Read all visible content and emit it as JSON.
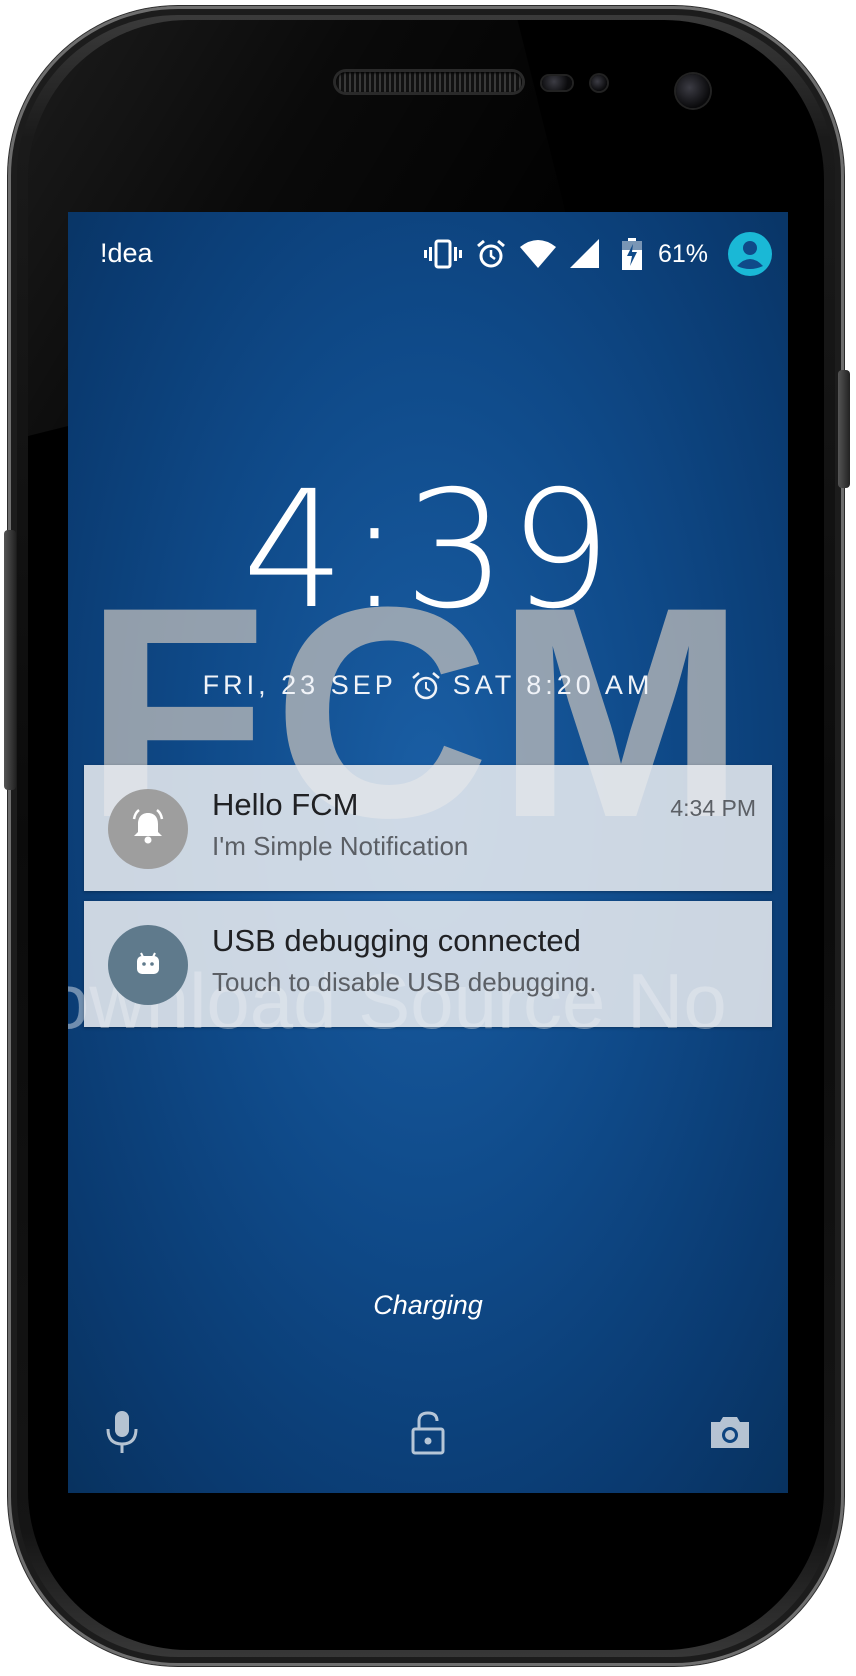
{
  "status_bar": {
    "carrier": "!dea",
    "battery_percent": "61%",
    "icons": [
      "vibrate-icon",
      "alarm-icon",
      "wifi-icon",
      "signal-icon",
      "battery-charging-icon",
      "user-avatar-icon"
    ]
  },
  "lockscreen": {
    "time": "4:39",
    "date": "FRI, 23 SEP",
    "next_alarm": "SAT 8:20 AM",
    "charging_status": "Charging"
  },
  "wallpaper": {
    "title": "FCM",
    "subtitle": "ownload Source No"
  },
  "notifications": [
    {
      "title": "Hello FCM",
      "text": "I'm Simple Notification",
      "time": "4:34 PM",
      "icon": "bell-icon",
      "icon_bg": "#9e9e9e"
    },
    {
      "title": "USB debugging connected",
      "text": "Touch to disable USB debugging.",
      "time": "",
      "icon": "android-icon",
      "icon_bg": "#5f7a8c"
    }
  ],
  "bottom_actions": [
    "microphone-icon",
    "lock-icon",
    "camera-icon"
  ],
  "colors": {
    "screen_bg": "#0f4a89",
    "avatar_accent": "#1ab8d6",
    "notification_bg": "#e7eaef"
  }
}
